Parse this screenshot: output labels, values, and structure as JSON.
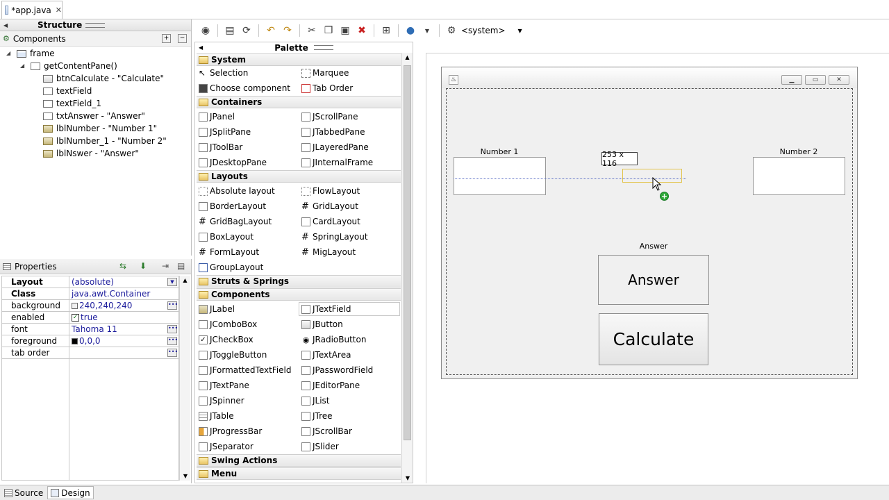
{
  "editor_tab": {
    "label": "*app.java"
  },
  "structure": {
    "title": "Structure",
    "components_header": "Components",
    "tree": [
      {
        "label": "frame"
      },
      {
        "label": "getContentPane()"
      },
      {
        "label": "btnCalculate - \"Calculate\""
      },
      {
        "label": "textField"
      },
      {
        "label": "textField_1"
      },
      {
        "label": "txtAnswer - \"Answer\""
      },
      {
        "label": "lblNumber - \"Number 1\""
      },
      {
        "label": "lblNumber_1 - \"Number 2\""
      },
      {
        "label": "lblNswer - \"Answer\""
      }
    ]
  },
  "properties": {
    "title": "Properties",
    "rows": [
      {
        "name": "Layout",
        "value": "(absolute)"
      },
      {
        "name": "Class",
        "value": "java.awt.Container"
      },
      {
        "name": "background",
        "value": "240,240,240"
      },
      {
        "name": "enabled",
        "value": "true"
      },
      {
        "name": "font",
        "value": "Tahoma 11"
      },
      {
        "name": "foreground",
        "value": "0,0,0"
      },
      {
        "name": "tab order",
        "value": ""
      }
    ]
  },
  "toolbar": {
    "lookandfeel": "<system>"
  },
  "palette": {
    "title": "Palette",
    "categories": [
      {
        "name": "System"
      },
      {
        "name": "Containers"
      },
      {
        "name": "Layouts"
      },
      {
        "name": "Struts & Springs"
      },
      {
        "name": "Components"
      },
      {
        "name": "Swing Actions"
      },
      {
        "name": "Menu"
      }
    ],
    "system": [
      "Selection",
      "Marquee",
      "Choose component",
      "Tab Order"
    ],
    "containers": [
      "JPanel",
      "JScrollPane",
      "JSplitPane",
      "JTabbedPane",
      "JToolBar",
      "JLayeredPane",
      "JDesktopPane",
      "JInternalFrame"
    ],
    "layouts": [
      "Absolute layout",
      "FlowLayout",
      "BorderLayout",
      "GridLayout",
      "GridBagLayout",
      "CardLayout",
      "BoxLayout",
      "SpringLayout",
      "FormLayout",
      "MigLayout",
      "GroupLayout"
    ],
    "components": [
      "JLabel",
      "JTextField",
      "JComboBox",
      "JButton",
      "JCheckBox",
      "JRadioButton",
      "JToggleButton",
      "JTextArea",
      "JFormattedTextField",
      "JPasswordField",
      "JTextPane",
      "JEditorPane",
      "JSpinner",
      "JList",
      "JTable",
      "JTree",
      "JProgressBar",
      "JScrollBar",
      "JSeparator",
      "JSlider"
    ]
  },
  "design": {
    "label_number1": "Number 1",
    "label_number2": "Number 2",
    "label_answer": "Answer",
    "answer_text": "Answer",
    "calculate_text": "Calculate",
    "size_tooltip": "253 x 116"
  },
  "bottom_tabs": {
    "source": "Source",
    "design": "Design"
  },
  "colors": {
    "selection_ghost": "#e2c44c",
    "add_badge": "#2fa83a",
    "value_text": "#1c1c9c"
  }
}
